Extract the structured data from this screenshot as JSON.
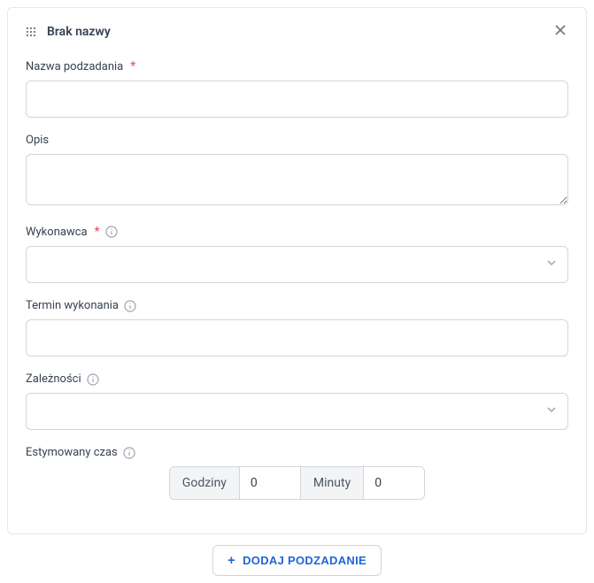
{
  "header": {
    "title": "Brak nazwy"
  },
  "fields": {
    "name": {
      "label": "Nazwa podzadania",
      "value": ""
    },
    "description": {
      "label": "Opis",
      "value": ""
    },
    "assignee": {
      "label": "Wykonawca",
      "value": ""
    },
    "dueDate": {
      "label": "Termin wykonania",
      "value": ""
    },
    "dependencies": {
      "label": "Zależności",
      "value": ""
    },
    "estimatedTime": {
      "label": "Estymowany czas",
      "hoursLabel": "Godziny",
      "hoursValue": "0",
      "minutesLabel": "Minuty",
      "minutesValue": "0"
    }
  },
  "actions": {
    "addSubtask": "DODAJ PODZADANIE"
  }
}
